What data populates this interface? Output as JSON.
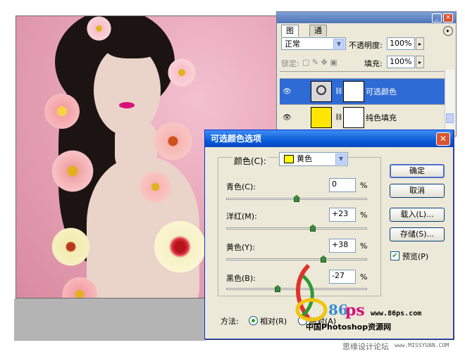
{
  "layers_panel": {
    "tabs": [
      "图层",
      "通道"
    ],
    "blend_mode": "正常",
    "opacity_label": "不透明度:",
    "opacity_value": "100%",
    "lock_label": "锁定:",
    "fill_label": "填充:",
    "fill_value": "100%",
    "layers": [
      {
        "name": "可选颜色",
        "selected": true,
        "thumb": "adjustment-icon"
      },
      {
        "name": "纯色填充",
        "selected": false,
        "thumb_color": "#ffe600"
      }
    ]
  },
  "dialog": {
    "title": "可选颜色选项",
    "color_label": "颜色(C):",
    "color_value": "黄色",
    "sliders": [
      {
        "label": "青色(C):",
        "value": "0",
        "unit": "%",
        "position": 0.5
      },
      {
        "label": "洋红(M):",
        "value": "+23",
        "unit": "%",
        "position": 0.615
      },
      {
        "label": "黄色(Y):",
        "value": "+38",
        "unit": "%",
        "position": 0.69
      },
      {
        "label": "黑色(B):",
        "value": "-27",
        "unit": "%",
        "position": 0.365
      }
    ],
    "buttons": {
      "ok": "确定",
      "cancel": "取消",
      "load": "载入(L)...",
      "save": "存储(S)..."
    },
    "preview_label": "预览(P)",
    "preview_checked": true,
    "method_label": "方法:",
    "method_relative": "相对(R)",
    "method_absolute": "绝对(A)",
    "method_selected": "relative"
  },
  "watermark": {
    "site_number": "86",
    "site_url": "www.86ps.com",
    "site_name": "中国Photoshop资源网",
    "footer": "思缘设计论坛",
    "footer_url": "www.MISSYUAN.COM"
  },
  "colors": {
    "title_blue": "#0a5fd8",
    "selected_layer": "#2f6bd4",
    "fill_yellow": "#ffe600",
    "dialog_bg": "#ece9d8"
  }
}
